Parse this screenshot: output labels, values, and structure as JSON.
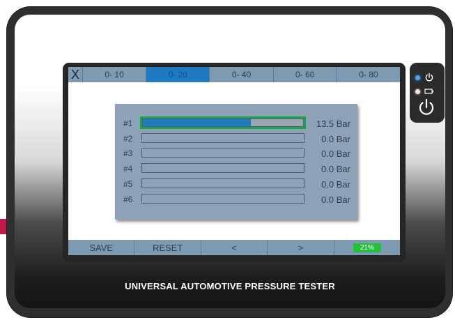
{
  "device": {
    "title": "UNIVERSAL AUTOMOTIVE PRESSURE TESTER"
  },
  "toolbar": {
    "close_label": "X",
    "tabs": [
      {
        "label": "0- 10",
        "active": false
      },
      {
        "label": "0- 20",
        "active": true
      },
      {
        "label": "0- 40",
        "active": false
      },
      {
        "label": "0- 60",
        "active": false
      },
      {
        "label": "0- 80",
        "active": false
      }
    ]
  },
  "sensors": [
    {
      "label": "#1",
      "value": "13.5 Bar",
      "fill_fraction": 0.675,
      "selected": true
    },
    {
      "label": "#2",
      "value": "0.0 Bar",
      "fill_fraction": 0,
      "selected": false
    },
    {
      "label": "#3",
      "value": "0.0 Bar",
      "fill_fraction": 0,
      "selected": false
    },
    {
      "label": "#4",
      "value": "0.0 Bar",
      "fill_fraction": 0,
      "selected": false
    },
    {
      "label": "#5",
      "value": "0.0 Bar",
      "fill_fraction": 0,
      "selected": false
    },
    {
      "label": "#6",
      "value": "0.0 Bar",
      "fill_fraction": 0,
      "selected": false
    }
  ],
  "bottom": {
    "save_label": "SAVE",
    "reset_label": "RESET",
    "prev_label": "<",
    "next_label": ">",
    "battery_label": "21%"
  },
  "side_controls": {
    "icons": [
      "power-icon",
      "battery-icon",
      "power-button-icon"
    ]
  },
  "colors": {
    "accent_blue": "#1f7ac2",
    "selection_green": "#1ea34b",
    "battery_green": "#22c03d",
    "toolbar_bg": "#7f9bb2",
    "panel_bg": "#8da2b6",
    "brand_pink": "#c1174b"
  }
}
